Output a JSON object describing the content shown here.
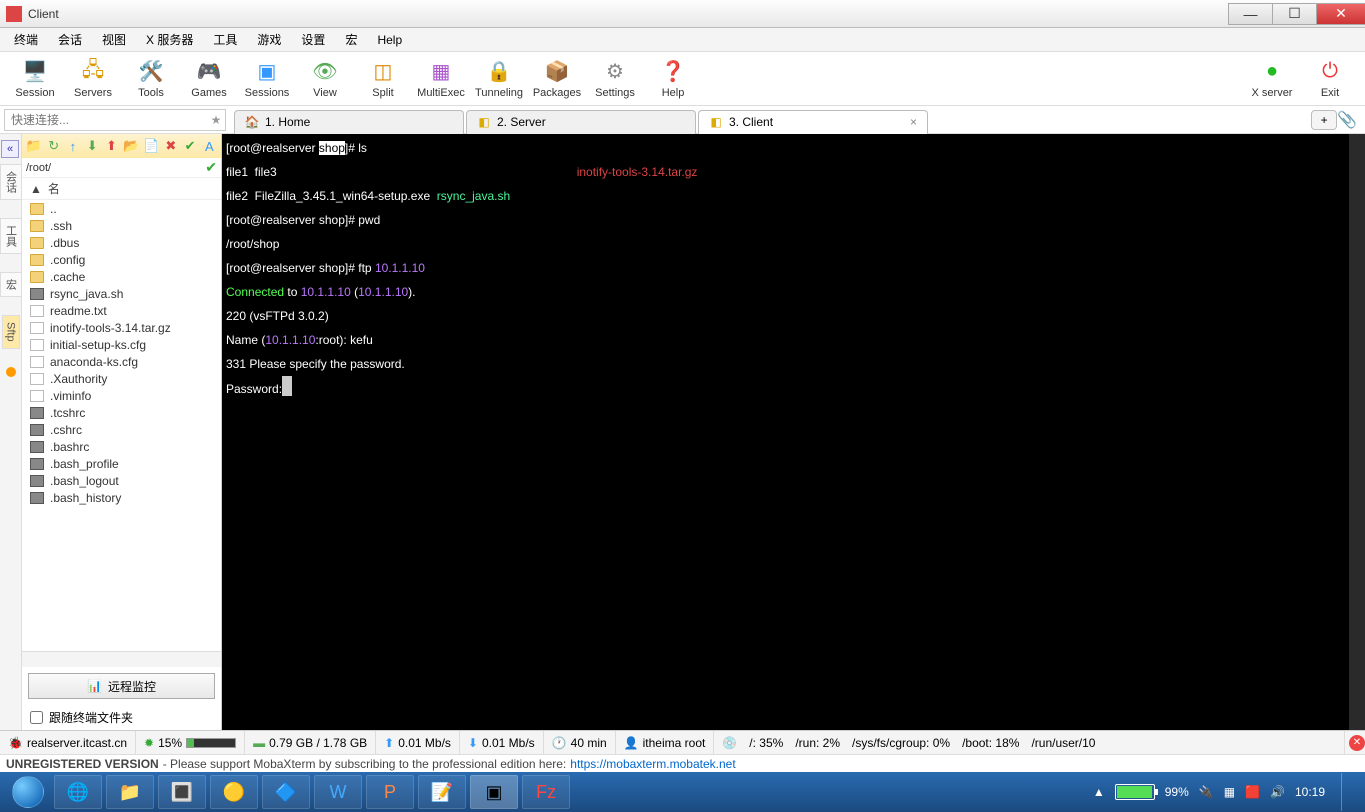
{
  "window": {
    "title": "Client"
  },
  "menu": [
    "终端",
    "会话",
    "视图",
    "X 服务器",
    "工具",
    "游戏",
    "设置",
    "宏",
    "Help"
  ],
  "toolbar": [
    {
      "icon": "🖥️",
      "label": "Session",
      "color": "#39f"
    },
    {
      "icon": "🖧",
      "label": "Servers",
      "color": "#d90"
    },
    {
      "icon": "🛠️",
      "label": "Tools",
      "color": "#555"
    },
    {
      "icon": "🎮",
      "label": "Games",
      "color": "#c4a"
    },
    {
      "icon": "▣",
      "label": "Sessions",
      "color": "#39f"
    },
    {
      "icon": "👁",
      "label": "View",
      "color": "#5a5"
    },
    {
      "icon": "◫",
      "label": "Split",
      "color": "#d80"
    },
    {
      "icon": "▦",
      "label": "MultiExec",
      "color": "#a5c"
    },
    {
      "icon": "🔒",
      "label": "Tunneling",
      "color": "#888"
    },
    {
      "icon": "📦",
      "label": "Packages",
      "color": "#c96"
    },
    {
      "icon": "⚙",
      "label": "Settings",
      "color": "#888"
    },
    {
      "icon": "❓",
      "label": "Help",
      "color": "#39f"
    }
  ],
  "toolbar_right": [
    {
      "icon": "●",
      "label": "X server",
      "color": "#2b2"
    },
    {
      "icon": "⏻",
      "label": "Exit",
      "color": "#e33"
    }
  ],
  "quick_placeholder": "快速连接...",
  "tabs": [
    {
      "icon": "🏠",
      "label": "1. Home",
      "active": false,
      "iconcolor": "#e70"
    },
    {
      "icon": "◧",
      "label": "2. Server",
      "active": false,
      "iconcolor": "#da0"
    },
    {
      "icon": "◧",
      "label": "3. Client",
      "active": true,
      "iconcolor": "#da0"
    }
  ],
  "sidebar": {
    "path": "/root/",
    "name_header": "名",
    "toolicons": [
      "📁",
      "↻",
      "↑",
      "⬇",
      "⬆",
      "📂",
      "📄",
      "✖",
      "✔",
      "A"
    ],
    "items": [
      {
        "t": "folder",
        "n": ".."
      },
      {
        "t": "folder",
        "n": ".ssh"
      },
      {
        "t": "folder",
        "n": ".dbus"
      },
      {
        "t": "folder",
        "n": ".config"
      },
      {
        "t": "folder",
        "n": ".cache"
      },
      {
        "t": "bfile",
        "n": "rsync_java.sh"
      },
      {
        "t": "tfile",
        "n": "readme.txt"
      },
      {
        "t": "tfile",
        "n": "inotify-tools-3.14.tar.gz"
      },
      {
        "t": "tfile",
        "n": "initial-setup-ks.cfg"
      },
      {
        "t": "tfile",
        "n": "anaconda-ks.cfg"
      },
      {
        "t": "tfile",
        "n": ".Xauthority"
      },
      {
        "t": "tfile",
        "n": ".viminfo"
      },
      {
        "t": "bfile",
        "n": ".tcshrc"
      },
      {
        "t": "bfile",
        "n": ".cshrc"
      },
      {
        "t": "bfile",
        "n": ".bashrc"
      },
      {
        "t": "bfile",
        "n": ".bash_profile"
      },
      {
        "t": "bfile",
        "n": ".bash_logout"
      },
      {
        "t": "bfile",
        "n": ".bash_history"
      }
    ],
    "monitor_btn": "远程监控",
    "follow_chk": "跟随终端文件夹"
  },
  "left_tabs": [
    "会话",
    "工具",
    "宏",
    "Sftp"
  ],
  "terminal": {
    "prompt1_a": "[root@realserver ",
    "prompt1_b": "shop",
    "prompt1_c": "]# ",
    "cmd1": "ls",
    "l2a": "file1  file3",
    "l2b": "inotify-tools-3.14.tar.gz",
    "l3a": "file2  FileZilla_3.45.1_win64-setup.exe  ",
    "l3b": "rsync_java.sh",
    "prompt2": "[root@realserver shop]# ",
    "cmd2": "pwd",
    "l5": "/root/shop",
    "prompt3": "[root@realserver shop]# ",
    "cmd3a": "ftp ",
    "cmd3b": "10.1.1.10",
    "l7a": "Connected",
    "l7b": " to ",
    "l7c": "10.1.1.10",
    "l7d": " (",
    "l7e": "10.1.1.10",
    "l7f": ").",
    "l8": "220 (vsFTPd 3.0.2)",
    "l9a": "Name (",
    "l9b": "10.1.1.10",
    "l9c": ":root): kefu",
    "l10": "331 Please specify the password.",
    "l11": "Password:"
  },
  "status": {
    "host": "realserver.itcast.cn",
    "cpu": "15%",
    "mem": "0.79 GB / 1.78 GB",
    "up": "0.01 Mb/s",
    "dn": "0.01 Mb/s",
    "time": "40 min",
    "user": "itheima  root",
    "disks": [
      "/: 35%",
      "/run: 2%",
      "/sys/fs/cgroup: 0%",
      "/boot: 18%",
      "/run/user/10"
    ]
  },
  "unreg": {
    "a": "UNREGISTERED VERSION",
    "b": " - Please support MobaXterm by subscribing to the professional edition here: ",
    "url": "https://mobaxterm.mobatek.net"
  },
  "tray": {
    "battery": "99%",
    "clock": "10:19"
  }
}
